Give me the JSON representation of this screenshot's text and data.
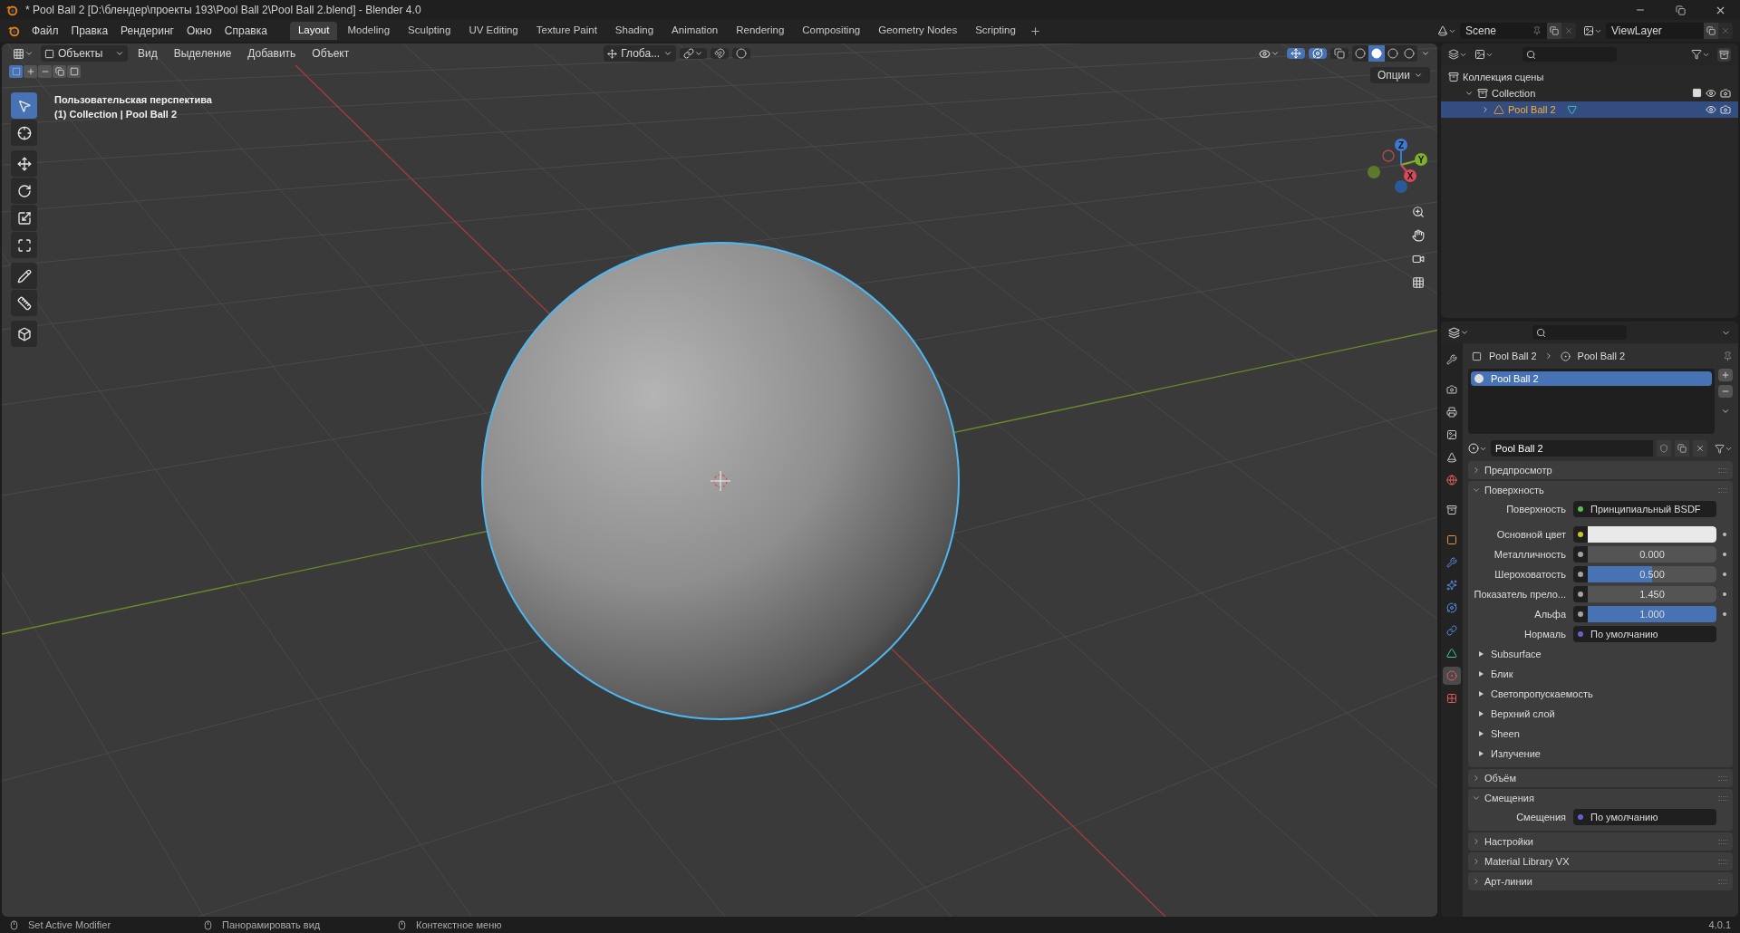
{
  "window": {
    "title": "* Pool Ball 2 [D:\\блендер\\проекты 193\\Pool Ball 2\\Pool Ball 2.blend] - Blender 4.0"
  },
  "menu": [
    "Файл",
    "Правка",
    "Рендеринг",
    "Окно",
    "Справка"
  ],
  "workspaces": [
    {
      "label": "Layout",
      "selected": true
    },
    {
      "label": "Modeling",
      "selected": false
    },
    {
      "label": "Sculpting",
      "selected": false
    },
    {
      "label": "UV Editing",
      "selected": false
    },
    {
      "label": "Texture Paint",
      "selected": false
    },
    {
      "label": "Shading",
      "selected": false
    },
    {
      "label": "Animation",
      "selected": false
    },
    {
      "label": "Rendering",
      "selected": false
    },
    {
      "label": "Compositing",
      "selected": false
    },
    {
      "label": "Geometry Nodes",
      "selected": false
    },
    {
      "label": "Scripting",
      "selected": false
    }
  ],
  "scene": {
    "name": "Scene"
  },
  "view_layer": {
    "name": "ViewLayer"
  },
  "viewport": {
    "mode": "Объекты",
    "menus": [
      "Вид",
      "Выделение",
      "Добавить",
      "Объект"
    ],
    "orientation": "Глоба...",
    "options": "Опции",
    "overlay_text": [
      "Пользовательская перспектива",
      "(1) Collection | Pool Ball 2"
    ],
    "select_modes": [
      {
        "kind": "new",
        "selected": true
      },
      {
        "kind": "extend",
        "selected": false
      },
      {
        "kind": "subtract",
        "selected": false
      },
      {
        "kind": "invert",
        "selected": false
      },
      {
        "kind": "intersect",
        "selected": false
      }
    ],
    "tools": [
      {
        "kind": "select",
        "selected": true
      },
      {
        "kind": "cursor",
        "selected": false
      },
      {
        "kind": "move",
        "selected": false
      },
      {
        "kind": "rotate",
        "selected": false
      },
      {
        "kind": "scale",
        "selected": false
      },
      {
        "kind": "transform",
        "selected": false
      },
      {
        "kind": "annotate",
        "selected": false
      },
      {
        "kind": "measure",
        "selected": false
      },
      {
        "kind": "add-cube",
        "selected": false
      }
    ],
    "shading": [
      {
        "kind": "wireframe",
        "selected": false
      },
      {
        "kind": "solid",
        "selected": true
      },
      {
        "kind": "material",
        "selected": false
      },
      {
        "kind": "rendered",
        "selected": false
      }
    ],
    "gizmo_axes": [
      "Z",
      "Y",
      "X"
    ],
    "snap_toggles": [
      {
        "kind": "snap",
        "on": false
      },
      {
        "kind": "proportional",
        "on": false
      }
    ],
    "display_toggles": [
      {
        "kind": "gizmo",
        "on": true
      },
      {
        "kind": "overlay",
        "on": true
      },
      {
        "kind": "xray",
        "on": false
      }
    ]
  },
  "outliner": {
    "items": [
      {
        "label": "Коллекция сцены",
        "kind": "scene-collection",
        "selected": false,
        "children": [
          {
            "label": "Collection",
            "kind": "collection",
            "selected": false,
            "expanded": true,
            "children": [
              {
                "label": "Pool Ball 2",
                "kind": "object",
                "selected": true,
                "expanded": false
              }
            ]
          }
        ]
      }
    ]
  },
  "properties": {
    "breadcrumb": [
      "Pool Ball 2",
      "Pool Ball 2"
    ],
    "tabs": [
      {
        "kind": "tool",
        "selected": false
      },
      {
        "kind": "render",
        "selected": false
      },
      {
        "kind": "output",
        "selected": false
      },
      {
        "kind": "view-layer",
        "selected": false
      },
      {
        "kind": "scene",
        "selected": false
      },
      {
        "kind": "world",
        "selected": false
      },
      {
        "kind": "collection",
        "selected": false
      },
      {
        "kind": "object",
        "selected": false
      },
      {
        "kind": "modifiers",
        "selected": false
      },
      {
        "kind": "particles",
        "selected": false
      },
      {
        "kind": "physics",
        "selected": false
      },
      {
        "kind": "constraints",
        "selected": false
      },
      {
        "kind": "data",
        "selected": false
      },
      {
        "kind": "material",
        "selected": true
      },
      {
        "kind": "texture",
        "selected": false
      }
    ],
    "slots": [
      {
        "label": "Pool Ball 2",
        "selected": true
      }
    ],
    "material": "Pool Ball 2",
    "panels": [
      {
        "title": "Предпросмотр",
        "expanded": false
      },
      {
        "title": "Поверхность",
        "expanded": true,
        "rows": [
          {
            "kind": "link",
            "label": "Поверхность",
            "value": "Принципиальный BSDF",
            "color": "#4fc24f"
          },
          {
            "kind": "swatch",
            "label": "Основной цвет",
            "swatch": {
              "color": "#e9e9e9"
            },
            "color": "#c7c729"
          },
          {
            "kind": "slider",
            "label": "Металличность",
            "value": "0.000",
            "level": 0,
            "color": "#a1a1a1"
          },
          {
            "kind": "slider",
            "label": "Шероховатость",
            "value": "0.500",
            "level": 0.5,
            "color": "#a1a1a1"
          },
          {
            "kind": "slider",
            "label": "Показатель прело...",
            "value": "1.450",
            "level": 0,
            "color": "#a1a1a1"
          },
          {
            "kind": "slider",
            "label": "Альфа",
            "value": "1.000",
            "level": 1,
            "color": "#a1a1a1"
          },
          {
            "kind": "link",
            "label": "Нормаль",
            "value": "По умолчанию",
            "color": "#6363c7"
          },
          {
            "kind": "subpanel",
            "label": "Subsurface"
          },
          {
            "kind": "subpanel",
            "label": "Блик"
          },
          {
            "kind": "subpanel",
            "label": "Светопропускаемость"
          },
          {
            "kind": "subpanel",
            "label": "Верхний слой"
          },
          {
            "kind": "subpanel",
            "label": "Sheen"
          },
          {
            "kind": "subpanel",
            "label": "Излучение"
          }
        ]
      },
      {
        "title": "Объём",
        "expanded": false
      },
      {
        "title": "Смещения",
        "expanded": true,
        "rows": [
          {
            "kind": "link",
            "label": "Смещения",
            "value": "По умолчанию",
            "color": "#6363c7"
          }
        ]
      },
      {
        "title": "Настройки",
        "expanded": false
      },
      {
        "title": "Material Library VX",
        "expanded": false
      },
      {
        "title": "Арт-линии",
        "expanded": false
      }
    ]
  },
  "status_bar": {
    "hints": [
      "Set Active Modifier",
      "Панорамировать вид",
      "Контекстное меню"
    ],
    "version": "4.0.1"
  }
}
